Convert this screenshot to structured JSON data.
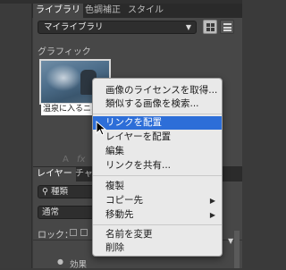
{
  "tabs": [
    {
      "label": "ライブラリ",
      "active": true
    },
    {
      "label": "色調補正",
      "active": false
    },
    {
      "label": "スタイル",
      "active": false
    }
  ],
  "library_select": {
    "value": "マイライブラリ"
  },
  "section_label": "グラフィック",
  "thumbnail": {
    "caption": "温泉に入るニホ"
  },
  "layers_panel": {
    "tabs": [
      {
        "label": "レイヤー"
      },
      {
        "label": "チャ"
      }
    ],
    "fx_icons": [
      "A",
      "fx"
    ],
    "filter_value": "種類",
    "blend_value": "通常",
    "lock_label": "ロック：",
    "effect_label": "効果"
  },
  "context_menu": {
    "items": [
      {
        "label": "画像のライセンスを取得...",
        "highlighted": false
      },
      {
        "label": "類似する画像を検索...",
        "highlighted": false
      },
      {
        "label": "リンクを配置",
        "highlighted": true
      },
      {
        "label": "レイヤーを配置",
        "highlighted": false
      },
      {
        "label": "編集",
        "highlighted": false
      },
      {
        "label": "リンクを共有...",
        "highlighted": false
      },
      {
        "label": "複製",
        "highlighted": false
      },
      {
        "label": "コピー先",
        "highlighted": false,
        "submenu": true
      },
      {
        "label": "移動先",
        "highlighted": false,
        "submenu": true
      },
      {
        "label": "名前を変更",
        "highlighted": false
      },
      {
        "label": "削除",
        "highlighted": false
      }
    ]
  },
  "colors": {
    "panel": "#474747",
    "highlight": "#2d6ed8",
    "menu_bg": "#e9e9e9"
  }
}
